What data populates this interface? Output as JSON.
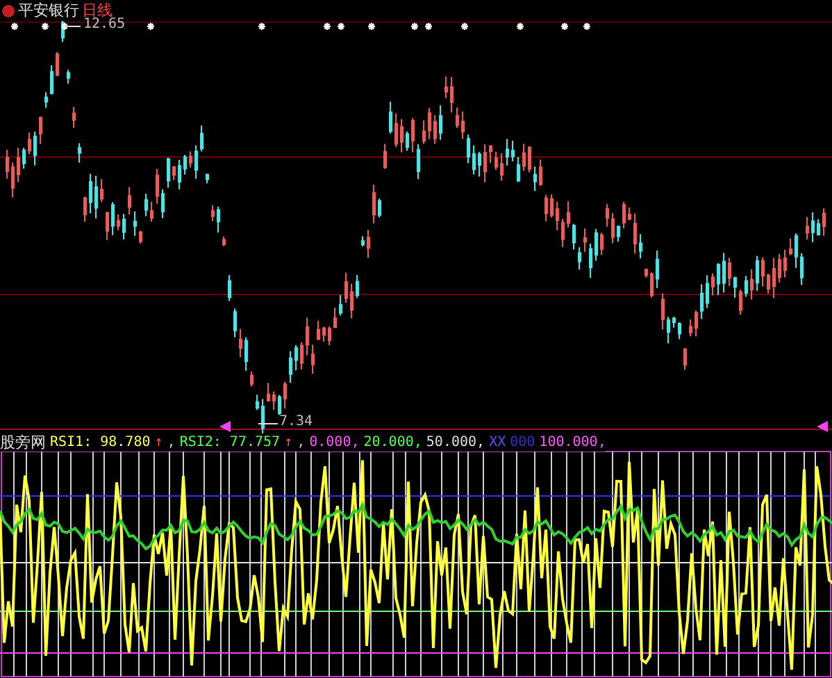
{
  "stock": {
    "name": "平安银行",
    "period": "日线"
  },
  "price_chart": {
    "high_label": "12.65",
    "low_label": "7.34"
  },
  "indicator": {
    "name": "股旁网",
    "items": [
      {
        "text": "RSI1: 98.780",
        "color": "#ffff54"
      },
      {
        "text": "↑",
        "color": "#ff5454"
      },
      {
        "text": ",",
        "color": "#c0c0c0"
      },
      {
        "text": "RSI2: 77.757",
        "color": "#54ff54"
      },
      {
        "text": "↑",
        "color": "#ff5454"
      },
      {
        "text": ",",
        "color": "#c0c0c0"
      },
      {
        "text": "0.000,",
        "color": "#ff54ff"
      },
      {
        "text": "20.000,",
        "color": "#54ff54"
      },
      {
        "text": "50.000,",
        "color": "#e0e0e0"
      },
      {
        "text": "XX",
        "color": "#5454ff"
      },
      {
        "text": "000",
        "color": "#3030d0"
      },
      {
        "text": "100.000,",
        "color": "#ff54ff"
      }
    ]
  }
}
